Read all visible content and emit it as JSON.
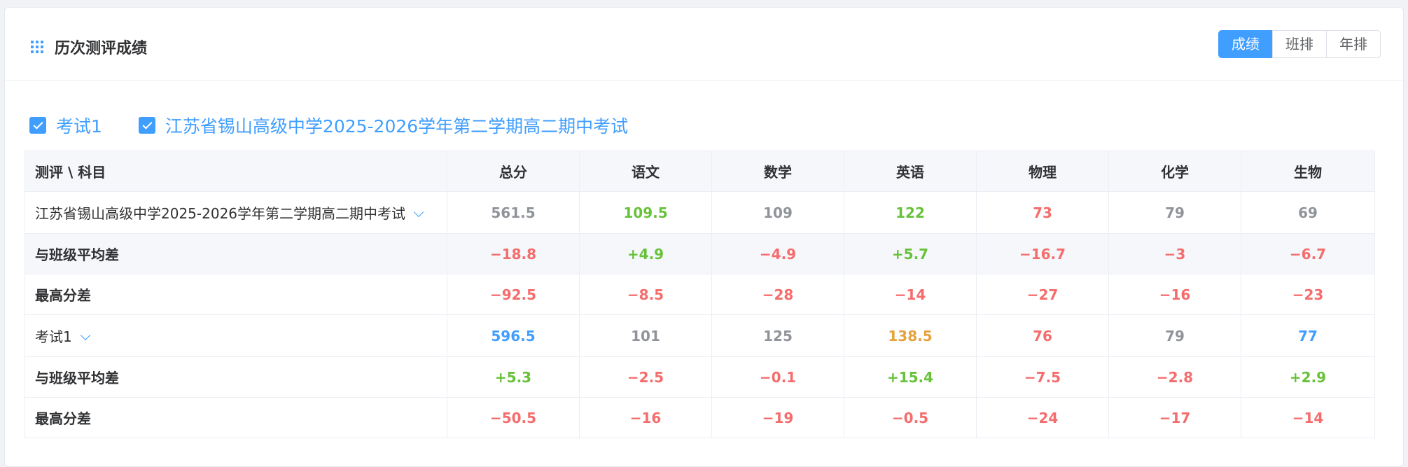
{
  "header": {
    "title": "历次测评成绩",
    "tabs": [
      "成绩",
      "班排",
      "年排"
    ],
    "active_tab": "成绩"
  },
  "filters": {
    "checkboxes": [
      {
        "label": "考试1",
        "checked": true
      },
      {
        "label": "江苏省锡山高级中学2025-2026学年第二学期高二期中考试",
        "checked": true
      }
    ]
  },
  "table": {
    "columns": [
      "测评 \\ 科目",
      "总分",
      "语文",
      "数学",
      "英语",
      "物理",
      "化学",
      "生物"
    ],
    "groups": [
      {
        "exam": "江苏省锡山高级中学2025-2026学年第二学期高二期中考试",
        "scores": [
          "561.5",
          "109.5",
          "109",
          "122",
          "73",
          "79",
          "69"
        ],
        "avg_diff_label": "与班级平均差",
        "avg_diff": [
          "−18.8",
          "+4.9",
          "−4.9",
          "+5.7",
          "−16.7",
          "−3",
          "−6.7"
        ],
        "max_diff_label": "最高分差",
        "max_diff": [
          "−92.5",
          "−8.5",
          "−28",
          "−14",
          "−27",
          "−16",
          "−23"
        ]
      },
      {
        "exam": "考试1",
        "scores": [
          "596.5",
          "101",
          "125",
          "138.5",
          "76",
          "79",
          "77"
        ],
        "avg_diff_label": "与班级平均差",
        "avg_diff": [
          "+5.3",
          "−2.5",
          "−0.1",
          "+15.4",
          "−7.5",
          "−2.8",
          "+2.9"
        ],
        "max_diff_label": "最高分差",
        "max_diff": [
          "−50.5",
          "−16",
          "−19",
          "−0.5",
          "−24",
          "−17",
          "−14"
        ]
      }
    ]
  },
  "colors": {
    "accent": "#409eff",
    "positive": "#67c23a",
    "negative": "#f56c6c",
    "neutral": "#909399",
    "highlight": "#e6a23c"
  }
}
